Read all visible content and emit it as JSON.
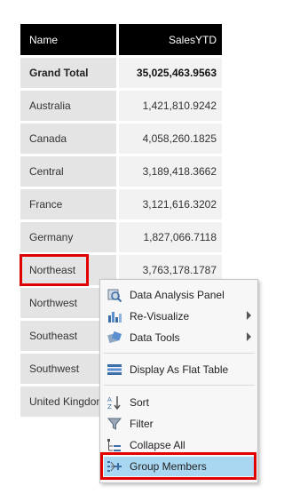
{
  "table": {
    "headers": {
      "name": "Name",
      "sales": "SalesYTD"
    },
    "grand_total": {
      "name": "Grand Total",
      "sales": "35,025,463.9563"
    },
    "rows": [
      {
        "name": "Australia",
        "sales": "1,421,810.9242"
      },
      {
        "name": "Canada",
        "sales": "4,058,260.1825"
      },
      {
        "name": "Central",
        "sales": "3,189,418.3662"
      },
      {
        "name": "France",
        "sales": "3,121,616.3202"
      },
      {
        "name": "Germany",
        "sales": "1,827,066.7118"
      },
      {
        "name": "Northeast",
        "sales": "3,763,178.1787"
      },
      {
        "name": "Northwest",
        "sales": ""
      },
      {
        "name": "Southeast",
        "sales": ""
      },
      {
        "name": "Southwest",
        "sales": ""
      },
      {
        "name": "United Kingdom",
        "sales": ""
      }
    ]
  },
  "context_menu": {
    "items": [
      {
        "label": "Data Analysis Panel",
        "icon": "data-analysis-icon",
        "submenu": false
      },
      {
        "label": "Re-Visualize",
        "icon": "chart-icon",
        "submenu": true
      },
      {
        "label": "Data Tools",
        "icon": "tools-icon",
        "submenu": true
      },
      {
        "label": "Display As Flat Table",
        "icon": "flat-table-icon",
        "submenu": false
      },
      {
        "label": "Sort",
        "icon": "sort-icon",
        "submenu": false
      },
      {
        "label": "Filter",
        "icon": "filter-icon",
        "submenu": false
      },
      {
        "label": "Collapse All",
        "icon": "collapse-icon",
        "submenu": false
      },
      {
        "label": "Group Members",
        "icon": "group-members-icon",
        "submenu": false
      }
    ]
  },
  "colors": {
    "highlight": "#e00000",
    "active_item": "#a9d6f0",
    "header_bg": "#000000"
  }
}
